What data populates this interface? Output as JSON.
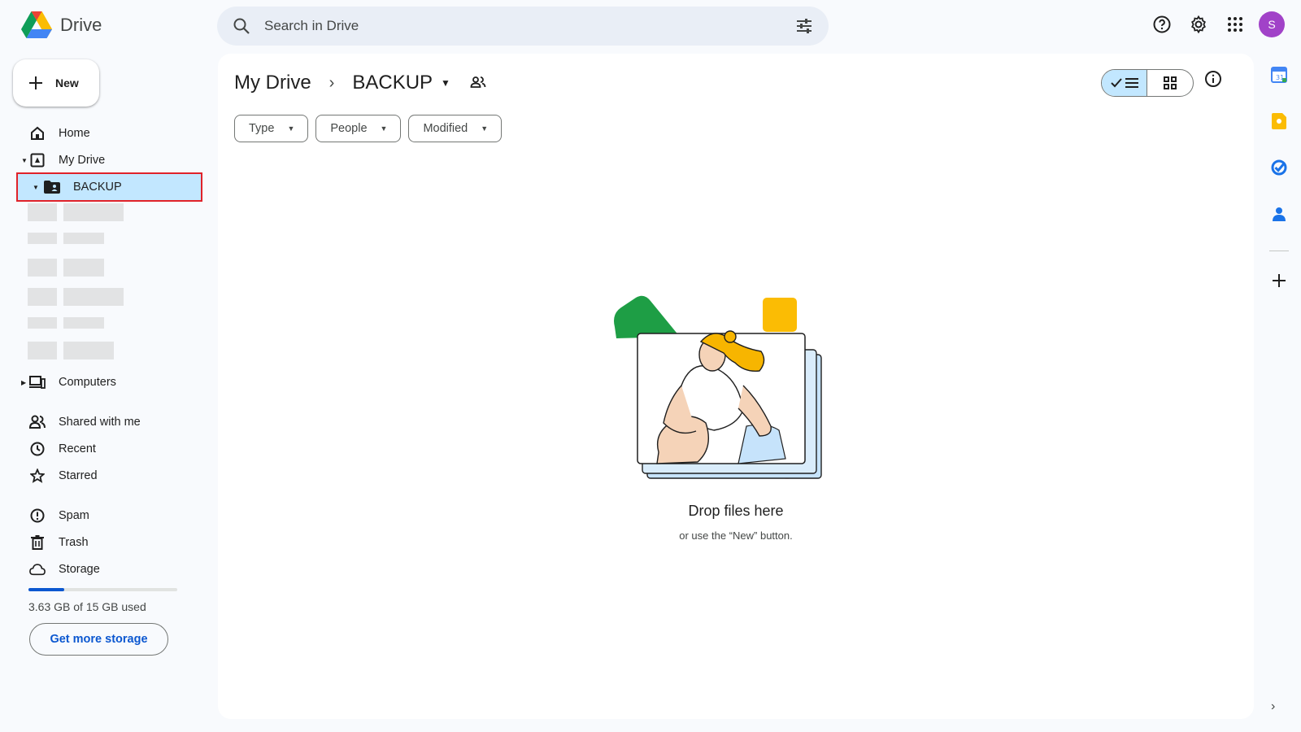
{
  "app": {
    "name": "Drive"
  },
  "search": {
    "placeholder": "Search in Drive"
  },
  "account": {
    "initial": "S",
    "color": "#a142c8"
  },
  "sidebar": {
    "new_label": "New",
    "items": [
      {
        "label": "Home",
        "icon": "home-icon"
      },
      {
        "label": "My Drive",
        "icon": "my-drive-icon"
      },
      {
        "label": "BACKUP",
        "icon": "shared-folder-icon",
        "selected": true
      },
      {
        "label": "Computers",
        "icon": "computers-icon"
      },
      {
        "label": "Shared with me",
        "icon": "shared-with-me-icon"
      },
      {
        "label": "Recent",
        "icon": "clock-icon"
      },
      {
        "label": "Starred",
        "icon": "star-icon"
      },
      {
        "label": "Spam",
        "icon": "spam-icon"
      },
      {
        "label": "Trash",
        "icon": "trash-icon"
      },
      {
        "label": "Storage",
        "icon": "cloud-icon"
      }
    ],
    "storage_text": "3.63 GB of 15 GB used",
    "storage_fraction": 0.242,
    "get_more_storage": "Get more storage"
  },
  "main": {
    "breadcrumb_root": "My Drive",
    "breadcrumb_current": "BACKUP",
    "filters": [
      "Type",
      "People",
      "Modified"
    ],
    "empty_title": "Drop files here",
    "empty_subtitle": "or use the “New” button."
  },
  "colors": {
    "accent": "#0b57d0",
    "selected_bg": "#c2e7ff",
    "highlight_border": "#e0222a"
  }
}
